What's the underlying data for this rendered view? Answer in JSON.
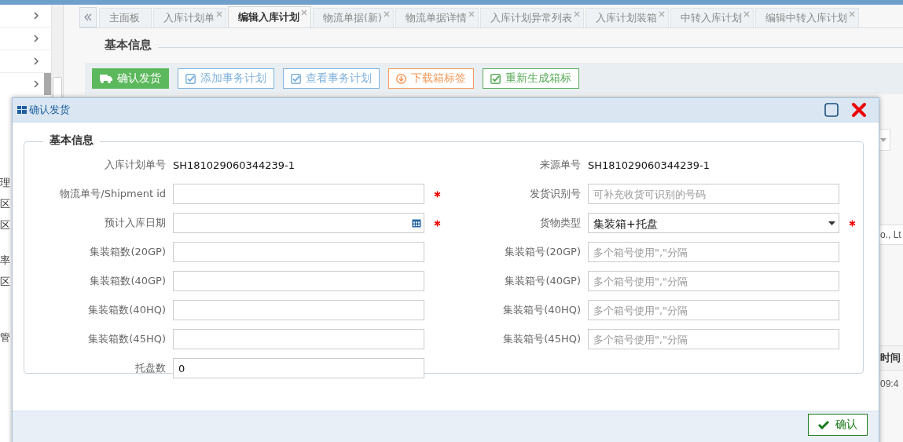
{
  "sidebar": {
    "items": [
      {
        "selected": false
      },
      {
        "selected": false
      },
      {
        "selected": false
      },
      {
        "selected": true
      }
    ],
    "cut_texts": [
      "理",
      "区",
      "区",
      "率",
      "区",
      "管"
    ]
  },
  "tabs": [
    {
      "label": "主面板",
      "closable": false,
      "selected": false
    },
    {
      "label": "入库计划单",
      "closable": true,
      "selected": false
    },
    {
      "label": "编辑入库计划",
      "closable": true,
      "selected": true
    },
    {
      "label": "物流单据(新)",
      "closable": true,
      "selected": false
    },
    {
      "label": "物流单据详情",
      "closable": true,
      "selected": false
    },
    {
      "label": "入库计划异常列表",
      "closable": true,
      "selected": false
    },
    {
      "label": "入库计划装箱",
      "closable": true,
      "selected": false
    },
    {
      "label": "中转入库计划",
      "closable": true,
      "selected": false
    },
    {
      "label": "编辑中转入库计划",
      "closable": true,
      "selected": false
    }
  ],
  "section_title": "基本信息",
  "toolbar": [
    {
      "label": "确认发货",
      "kind": "primary",
      "color": "#5cb85c"
    },
    {
      "label": "添加事务计划",
      "kind": "check",
      "color": "#7eb2dd"
    },
    {
      "label": "查看事务计划",
      "kind": "check",
      "color": "#7eb2dd"
    },
    {
      "label": "下载箱标签",
      "kind": "download",
      "color": "#f59a5a"
    },
    {
      "label": "重新生成箱标",
      "kind": "check",
      "color": "#5cad5c"
    }
  ],
  "background_right": {
    "cut_texts": [
      "o., Lt",
      "时间",
      "09:4"
    ]
  },
  "dialog": {
    "title": "确认发货",
    "section_title": "基本信息",
    "rows": [
      {
        "left": {
          "label": "入库计划单号",
          "kind": "static",
          "value": "SH181029060344239-1",
          "required": false
        },
        "right": {
          "label": "来源单号",
          "kind": "static",
          "value": "SH181029060344239-1",
          "required": false
        }
      },
      {
        "left": {
          "label": "物流单号/Shipment id",
          "kind": "text",
          "required": true
        },
        "right": {
          "label": "发货识别号",
          "kind": "text",
          "placeholder": "可补充收货可识别的号码",
          "required": false
        }
      },
      {
        "left": {
          "label": "预计入库日期",
          "kind": "date",
          "required": true
        },
        "right": {
          "label": "货物类型",
          "kind": "select",
          "value": "集装箱+托盘",
          "required": true
        }
      },
      {
        "left": {
          "label": "集装箱数(20GP)",
          "kind": "text",
          "required": false
        },
        "right": {
          "label": "集装箱号(20GP)",
          "kind": "text",
          "placeholder": "多个箱号使用\",\"分隔",
          "required": false
        }
      },
      {
        "left": {
          "label": "集装箱数(40GP)",
          "kind": "text",
          "required": false
        },
        "right": {
          "label": "集装箱号(40GP)",
          "kind": "text",
          "placeholder": "多个箱号使用\",\"分隔",
          "required": false
        }
      },
      {
        "left": {
          "label": "集装箱数(40HQ)",
          "kind": "text",
          "required": false
        },
        "right": {
          "label": "集装箱号(40HQ)",
          "kind": "text",
          "placeholder": "多个箱号使用\",\"分隔",
          "required": false
        }
      },
      {
        "left": {
          "label": "集装箱数(45HQ)",
          "kind": "text",
          "required": false
        },
        "right": {
          "label": "集装箱号(45HQ)",
          "kind": "text",
          "placeholder": "多个箱号使用\",\"分隔",
          "required": false
        }
      },
      {
        "left": {
          "label": "托盘数",
          "kind": "text",
          "value": "0",
          "required": false
        }
      }
    ],
    "confirm_button": "确认"
  }
}
